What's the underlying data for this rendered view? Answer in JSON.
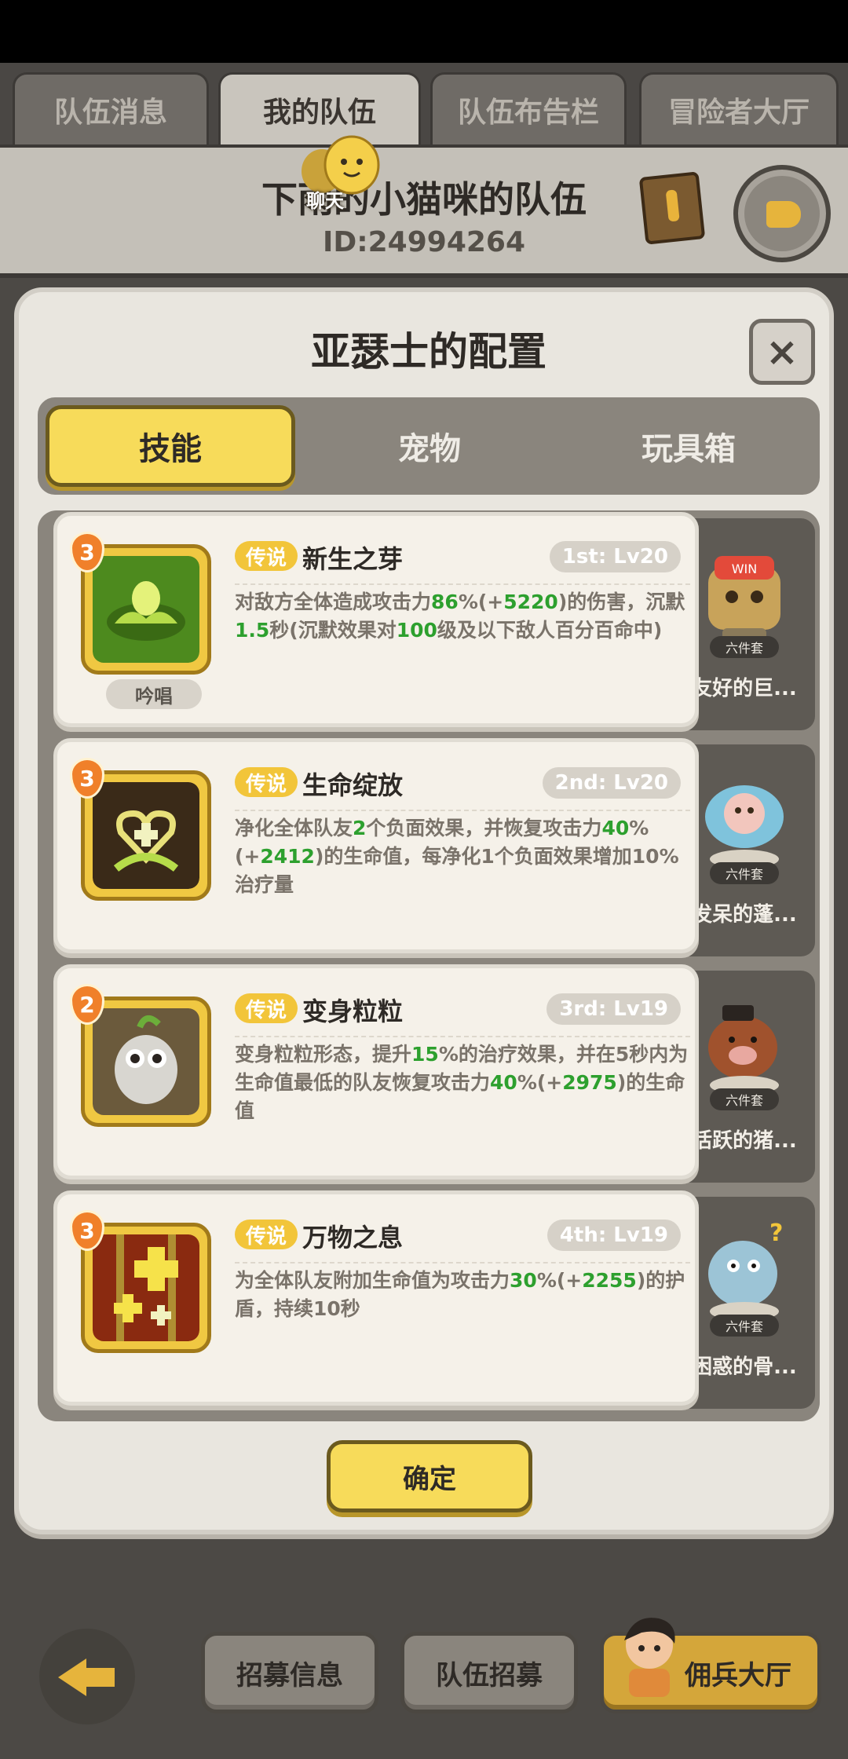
{
  "top_tabs": [
    "队伍消息",
    "我的队伍",
    "队伍布告栏",
    "冒险者大厅"
  ],
  "team": {
    "name": "下雨的小猫咪的队伍",
    "id": "ID:24994264",
    "chat_label": "聊天"
  },
  "modal": {
    "title": "亚瑟士的配置",
    "close_label": "×",
    "tabs": [
      "技能",
      "宠物",
      "玩具箱"
    ],
    "confirm_label": "确定"
  },
  "skills": [
    {
      "level": "3",
      "rarity": "传说",
      "name": "新生之芽",
      "slot": "1st: Lv20",
      "badge": "吟唱",
      "desc_parts": [
        {
          "t": "对敌方全体造成攻击力"
        },
        {
          "t": "86",
          "hl": true
        },
        {
          "t": "%(+"
        },
        {
          "t": "5220",
          "hl": true
        },
        {
          "t": ")的伤害，沉默"
        },
        {
          "t": "1.5",
          "hl": true
        },
        {
          "t": "秒(沉默效果对"
        },
        {
          "t": "100",
          "hl": true
        },
        {
          "t": "级及以下敌人百分百命中)"
        }
      ],
      "icon_color": "#4d8a1e"
    },
    {
      "level": "3",
      "rarity": "传说",
      "name": "生命绽放",
      "slot": "2nd: Lv20",
      "badge": "",
      "desc_parts": [
        {
          "t": "净化全体队友"
        },
        {
          "t": "2",
          "hl": true
        },
        {
          "t": "个负面效果，并恢复攻击力"
        },
        {
          "t": "40",
          "hl": true
        },
        {
          "t": "%(+"
        },
        {
          "t": "2412",
          "hl": true
        },
        {
          "t": ")的生命值，每净化1个负面效果增加10%治疗量"
        }
      ],
      "icon_color": "#3a2a18"
    },
    {
      "level": "2",
      "rarity": "传说",
      "name": "变身粒粒",
      "slot": "3rd: Lv19",
      "badge": "",
      "desc_parts": [
        {
          "t": "变身粒粒形态，提升"
        },
        {
          "t": "15",
          "hl": true
        },
        {
          "t": "%的治疗效果，并在5秒内为生命值最低的队友恢复攻击力"
        },
        {
          "t": "40",
          "hl": true
        },
        {
          "t": "%(+"
        },
        {
          "t": "2975",
          "hl": true
        },
        {
          "t": ")的生命值"
        }
      ],
      "icon_color": "#6b5a3c"
    },
    {
      "level": "3",
      "rarity": "传说",
      "name": "万物之息",
      "slot": "4th: Lv19",
      "badge": "",
      "desc_parts": [
        {
          "t": "为全体队友附加生命值为攻击力"
        },
        {
          "t": "30",
          "hl": true
        },
        {
          "t": "%(+"
        },
        {
          "t": "2255",
          "hl": true
        },
        {
          "t": ")的护盾，持续10秒"
        }
      ],
      "icon_color": "#8a2a10"
    }
  ],
  "pets": [
    {
      "badge": "六件套",
      "name": "友好的巨..."
    },
    {
      "badge": "六件套",
      "name": "发呆的蓬..."
    },
    {
      "badge": "六件套",
      "name": "活跃的猪..."
    },
    {
      "badge": "六件套",
      "name": "困惑的骨..."
    }
  ],
  "bottom": {
    "recruit_info": "招募信息",
    "team_recruit": "队伍招募",
    "mercenary_hall": "佣兵大厅"
  },
  "colors": {
    "accent_yellow": "#f7db5a",
    "highlight_green": "#2da02e",
    "rarity_gold": "#f2c53a"
  }
}
